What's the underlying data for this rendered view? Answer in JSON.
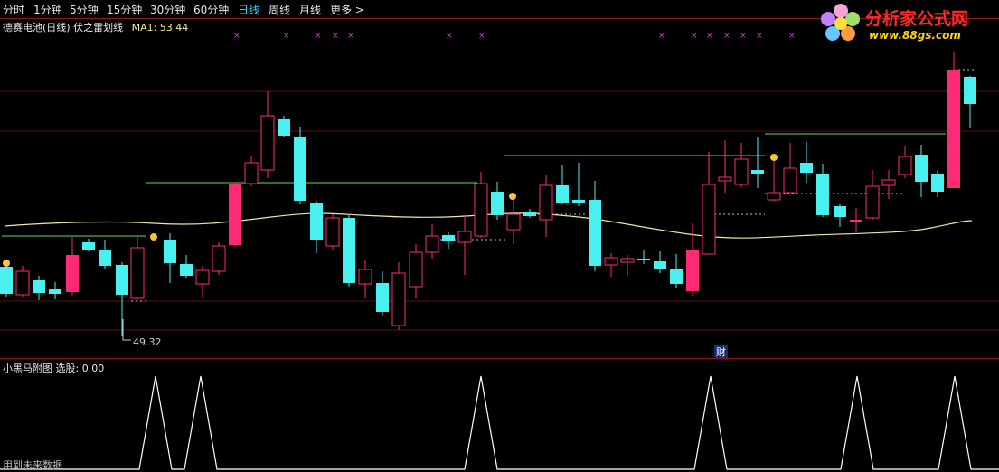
{
  "toolbar": {
    "periods": [
      {
        "label": "分时",
        "active": false
      },
      {
        "label": "1分钟",
        "active": false
      },
      {
        "label": "5分钟",
        "active": false
      },
      {
        "label": "15分钟",
        "active": false
      },
      {
        "label": "30分钟",
        "active": false
      },
      {
        "label": "60分钟",
        "active": false
      },
      {
        "label": "日线",
        "active": true
      },
      {
        "label": "周线",
        "active": false
      },
      {
        "label": "月线",
        "active": false
      },
      {
        "label": "更多 >",
        "active": false
      }
    ]
  },
  "main_panel": {
    "stock_name": "德赛电池(日线)",
    "indicator_name": "伏之雷划线",
    "ma_label": "MA1: 53.44",
    "low_price_label": "49.32",
    "event_badge": "财"
  },
  "sub_panel": {
    "title": "小黑马附图",
    "value_label": "选股: 0.00",
    "footer": "用到未来数据"
  },
  "watermark": {
    "title": "分析家公式网",
    "url": "www.88gs.com"
  },
  "colors": {
    "up_candle": "#ff2a75",
    "down_candle": "#49f0f0",
    "ma_line": "#efe7a8",
    "green_line": "#5fdc5f",
    "marker": "#c040c0",
    "separator": "#8a1a1a"
  },
  "chart_data": {
    "type": "candlestick",
    "low_price": 49.32,
    "ma1": 53.44,
    "sub_chart": {
      "type": "line",
      "title": "小黑马附图",
      "signal_value": 0.0,
      "peaks": 7
    }
  }
}
